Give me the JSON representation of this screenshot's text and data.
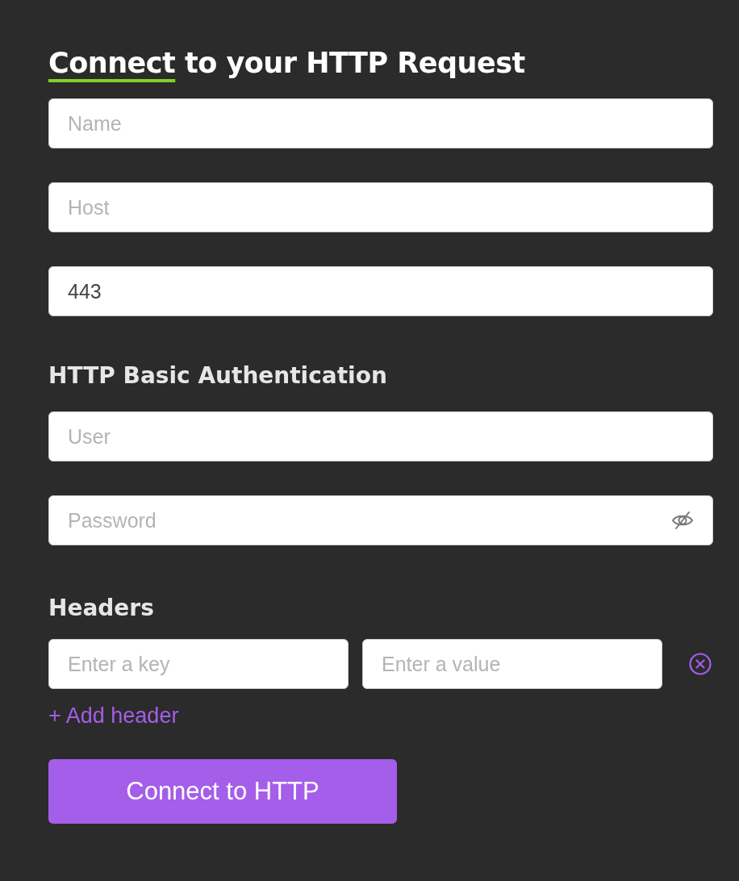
{
  "title": {
    "highlight": "Connect",
    "rest": "to your HTTP Request"
  },
  "connection_fields": [
    {
      "kind": "text",
      "placeholder": "Name"
    },
    {
      "kind": "text",
      "placeholder": "Host"
    },
    {
      "kind": "text",
      "value": "443"
    }
  ],
  "auth": {
    "heading": "HTTP Basic Authentication",
    "fields": [
      {
        "kind": "text",
        "placeholder": "User"
      },
      {
        "kind": "password",
        "placeholder": "Password"
      }
    ]
  },
  "headers": {
    "heading": "Headers",
    "rows": [
      {
        "key_placeholder": "Enter a key",
        "value_placeholder": "Enter a value"
      }
    ],
    "add_link": "+ Add header"
  },
  "submit_button": "Connect to HTTP"
}
